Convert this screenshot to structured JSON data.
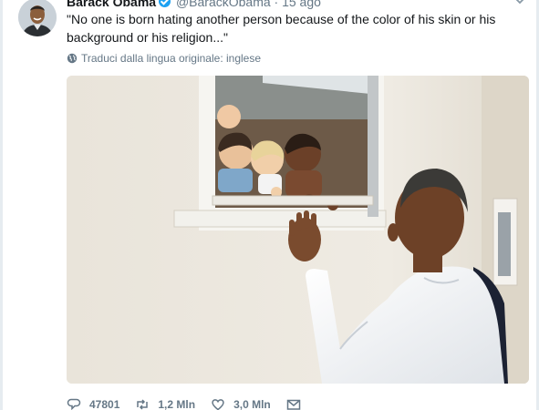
{
  "tweet": {
    "author_name": "Barack Obama",
    "author_handle": "@BarackObama",
    "time": "· 15 ago",
    "text": "\"No one is born hating another person because of the color of his skin or his background or his religion...\"",
    "translate_label": "Traduci dalla lingua originale: inglese"
  },
  "actions": {
    "replies": "47801",
    "retweets": "1,2 Mln",
    "likes": "3,0 Mln"
  },
  "icons": {
    "verified": "verified-badge-icon",
    "caret": "chevron-down-icon",
    "globe": "globe-icon",
    "reply": "reply-icon",
    "retweet": "retweet-icon",
    "like": "heart-icon",
    "dm": "envelope-icon"
  },
  "colors": {
    "accent": "#1da1f2",
    "muted": "#657786",
    "text": "#14171a"
  }
}
